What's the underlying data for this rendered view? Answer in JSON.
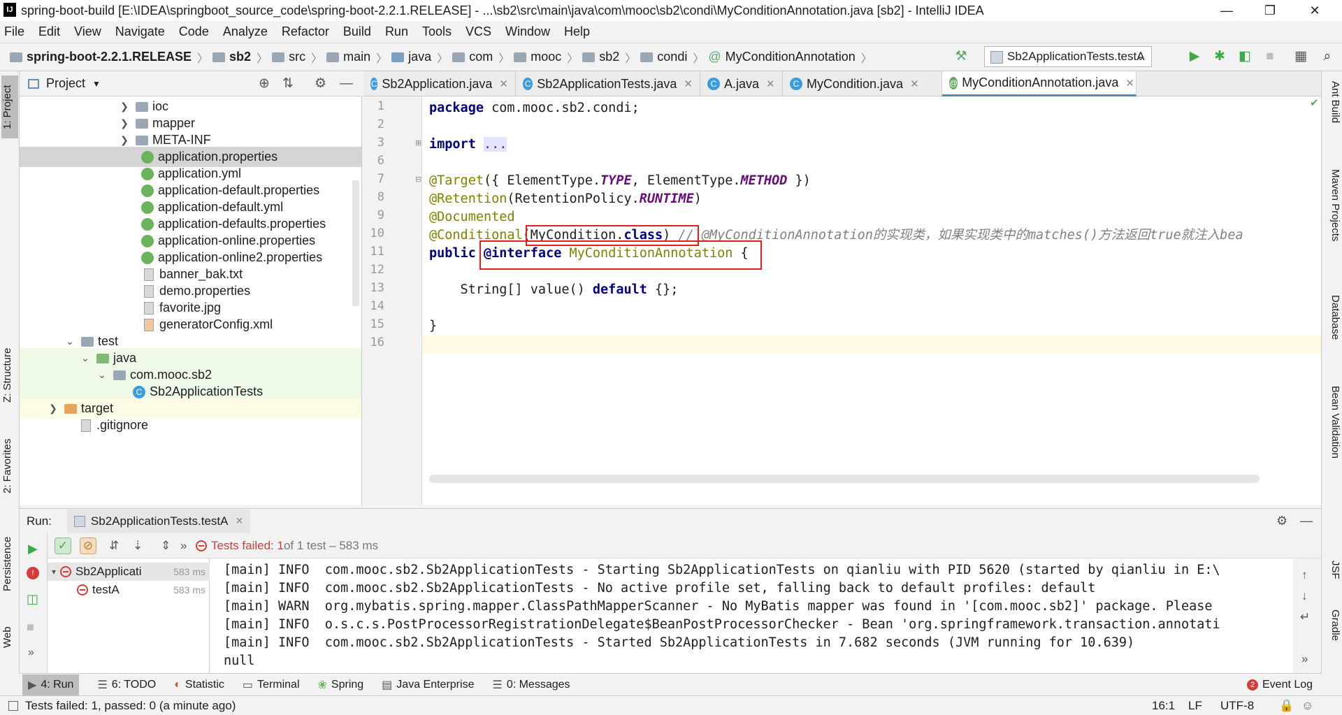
{
  "window": {
    "title": "spring-boot-build [E:\\IDEA\\springboot_source_code\\spring-boot-2.2.1.RELEASE] - ...\\sb2\\src\\main\\java\\com\\mooc\\sb2\\condi\\MyConditionAnnotation.java [sb2] - IntelliJ IDEA",
    "minimize": "—",
    "maximize": "❐",
    "close": "✕"
  },
  "menu": [
    "File",
    "Edit",
    "View",
    "Navigate",
    "Code",
    "Analyze",
    "Refactor",
    "Build",
    "Run",
    "Tools",
    "VCS",
    "Window",
    "Help"
  ],
  "breadcrumbs": [
    "spring-boot-2.2.1.RELEASE",
    "sb2",
    "src",
    "main",
    "java",
    "com",
    "mooc",
    "sb2",
    "condi",
    "MyConditionAnnotation"
  ],
  "run_config": "Sb2ApplicationTests.testA",
  "left_stripe": {
    "project": "1: Project",
    "structure": "Z: Structure",
    "favorites": "2: Favorites",
    "persistence": "Persistence",
    "web": "Web"
  },
  "right_stripe": [
    "Ant Build",
    "Maven Projects",
    "Database",
    "Bean Validation",
    "JSF",
    "Gradle"
  ],
  "project_panel": {
    "title": "Project",
    "tree": [
      {
        "label": "ioc",
        "type": "folder",
        "arrow": ">"
      },
      {
        "label": "mapper",
        "type": "folder",
        "arrow": ">"
      },
      {
        "label": "META-INF",
        "type": "folder",
        "arrow": ">"
      },
      {
        "label": "application.properties",
        "type": "spring"
      },
      {
        "label": "application.yml",
        "type": "spring"
      },
      {
        "label": "application-default.properties",
        "type": "spring"
      },
      {
        "label": "application-default.yml",
        "type": "spring"
      },
      {
        "label": "application-defaults.properties",
        "type": "spring"
      },
      {
        "label": "application-online.properties",
        "type": "spring"
      },
      {
        "label": "application-online2.properties",
        "type": "spring"
      },
      {
        "label": "banner_bak.txt",
        "type": "file"
      },
      {
        "label": "demo.properties",
        "type": "file"
      },
      {
        "label": "favorite.jpg",
        "type": "file"
      },
      {
        "label": "generatorConfig.xml",
        "type": "file"
      },
      {
        "label": "test",
        "type": "folder",
        "arrow": "v"
      },
      {
        "label": "java",
        "type": "folder-green",
        "arrow": "v"
      },
      {
        "label": "com.mooc.sb2",
        "type": "folder",
        "arrow": "v"
      },
      {
        "label": "Sb2ApplicationTests",
        "type": "class"
      },
      {
        "label": "target",
        "type": "folder-orange",
        "arrow": ">"
      },
      {
        "label": ".gitignore",
        "type": "file"
      }
    ]
  },
  "editor_tabs": [
    {
      "label": "Sb2Application.java",
      "icon": "C"
    },
    {
      "label": "Sb2ApplicationTests.java",
      "icon": "C"
    },
    {
      "label": "A.java",
      "icon": "C"
    },
    {
      "label": "MyCondition.java",
      "icon": "C"
    },
    {
      "label": "MyConditionAnnotation.java",
      "icon": "@"
    }
  ],
  "editor": {
    "line_numbers": [
      "1",
      "2",
      "3",
      "6",
      "7",
      "8",
      "9",
      "10",
      "11",
      "12",
      "13",
      "14",
      "15",
      "16"
    ],
    "code": {
      "l1_kw": "package",
      "l1_rest": " com.mooc.sb2.condi;",
      "l3_kw": "import",
      "l3_fold": "...",
      "l7_ann": "@Target",
      "l7_a": "({ ElementType.",
      "l7_c1": "TYPE",
      "l7_b": ", ElementType.",
      "l7_c2": "METHOD",
      "l7_d": " })",
      "l8_ann": "@Retention",
      "l8_a": "(RetentionPolicy.",
      "l8_c": "RUNTIME",
      "l8_d": ")",
      "l9_ann": "@Documented",
      "l10_ann": "@Conditional",
      "l10_a": "(MyCondition.",
      "l10_kw": "class",
      "l10_b": ") ",
      "l10_cmt": "// @MyConditionAnnotation的实现类，如果实现类中的matches()方法返回true就注入bea",
      "l11_kw": "public",
      "l11_kw2": "@interface",
      "l11_name": "MyConditionAnnotation",
      "l11_rest": " {",
      "l13_a": "    String[] value() ",
      "l13_kw": "default",
      "l13_b": " {};",
      "l15": "}"
    }
  },
  "run_panel": {
    "label": "Run:",
    "tab": "Sb2ApplicationTests.testA",
    "status_prefix": "Tests failed: 1",
    "status_suffix": " of 1 test – 583 ms",
    "tests": [
      {
        "name": "Sb2Applicati",
        "time": "583 ms"
      },
      {
        "name": "testA",
        "time": "583 ms"
      }
    ],
    "console": [
      "[main] INFO  com.mooc.sb2.Sb2ApplicationTests - Starting Sb2ApplicationTests on qianliu with PID 5620 (started by qianliu in E:\\",
      "[main] INFO  com.mooc.sb2.Sb2ApplicationTests - No active profile set, falling back to default profiles: default",
      "[main] WARN  org.mybatis.spring.mapper.ClassPathMapperScanner - No MyBatis mapper was found in '[com.mooc.sb2]' package. Please",
      "[main] INFO  o.s.c.s.PostProcessorRegistrationDelegate$BeanPostProcessorChecker - Bean 'org.springframework.transaction.annotati",
      "[main] INFO  com.mooc.sb2.Sb2ApplicationTests - Started Sb2ApplicationTests in 7.682 seconds (JVM running for 10.639)",
      "null"
    ]
  },
  "tool_windows": [
    {
      "label": "4: Run",
      "icon": "▶"
    },
    {
      "label": "6: TODO",
      "icon": "☰"
    },
    {
      "label": "Statistic",
      "icon": "◐"
    },
    {
      "label": "Terminal",
      "icon": "▭"
    },
    {
      "label": "Spring",
      "icon": "❀"
    },
    {
      "label": "Java Enterprise",
      "icon": "▤"
    },
    {
      "label": "0: Messages",
      "icon": "☰"
    }
  ],
  "event_log": {
    "count": "2",
    "label": "Event Log"
  },
  "statusbar": {
    "message": "Tests failed: 1, passed: 0 (a minute ago)",
    "position": "16:1",
    "line_sep": "LF",
    "encoding": "UTF-8"
  },
  "colors": {
    "accent": "#4a88c7",
    "error": "#d43c3c",
    "success": "#59a869",
    "highlight_box": "#e02020"
  }
}
